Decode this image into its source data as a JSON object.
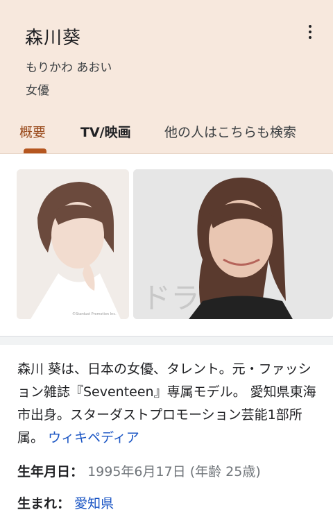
{
  "header": {
    "name": "森川葵",
    "reading": "もりかわ あおい",
    "role": "女優"
  },
  "tabs": [
    {
      "label": "概要",
      "active": true
    },
    {
      "label": "TV/映画",
      "active": false
    },
    {
      "label": "他の人はこちらも検索",
      "active": false
    }
  ],
  "photos": [
    {
      "credit": "©Stardust Promotion Inc."
    },
    {
      "partial_text": "ドラ"
    }
  ],
  "description": {
    "text": "森川 葵は、日本の女優、タレント。元・ファッション雑誌『Seventeen』専属モデル。 愛知県東海市出身。スターダストプロモーション芸能1部所属。",
    "source_link": "ウィキペディア"
  },
  "facts": {
    "birth_label": "生年月日：",
    "birth_value": "1995年6月17日 (年齢 25歳)",
    "origin_label": "生まれ：",
    "origin_value": "愛知県"
  },
  "colors": {
    "header_bg": "#f7e8dd",
    "accent": "#b5561f",
    "link": "#1a55c4"
  }
}
